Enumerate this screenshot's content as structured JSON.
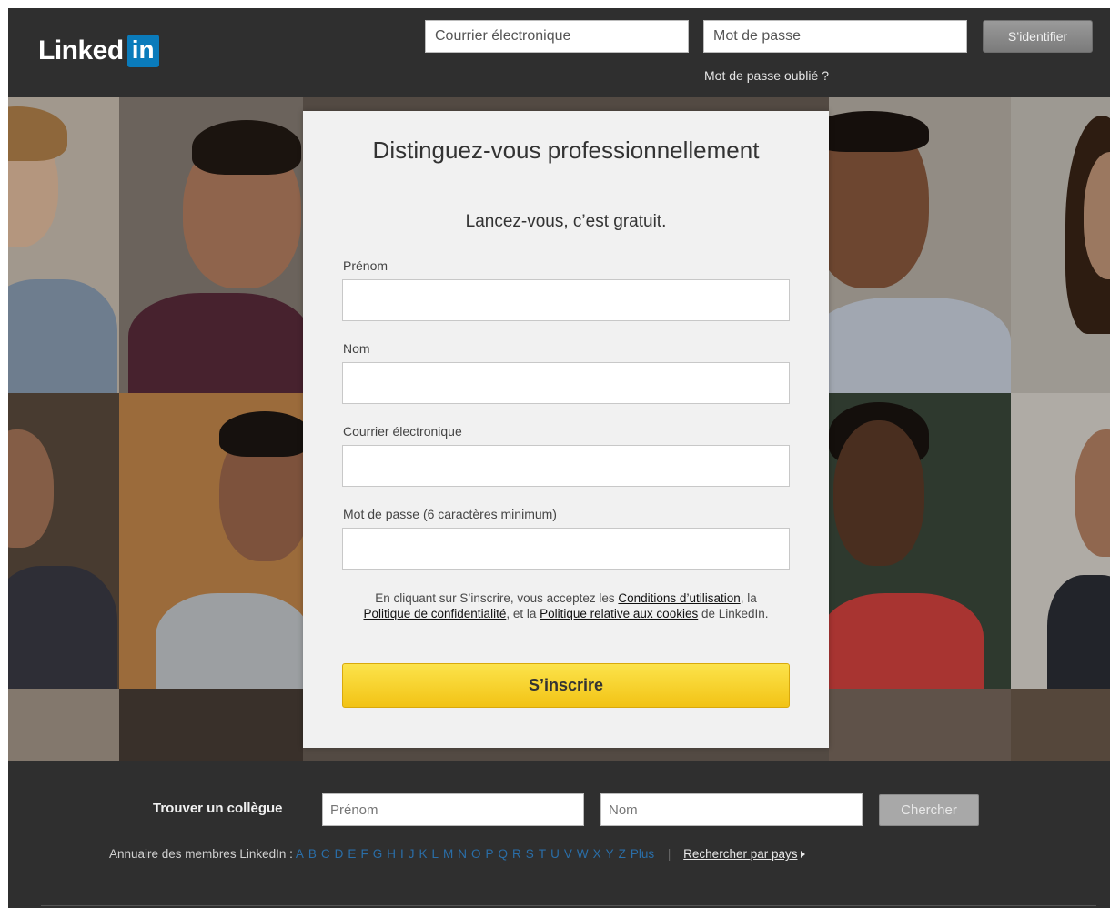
{
  "header": {
    "logo_word": "Linked",
    "logo_box": "in",
    "email_placeholder": "Courrier électronique",
    "password_placeholder": "Mot de passe",
    "signin_label": "S’identifier",
    "forgot_label": "Mot de passe oublié ?"
  },
  "signup": {
    "title": "Distinguez-vous professionnellement",
    "subtitle": "Lancez-vous, c’est gratuit.",
    "first_name_label": "Prénom",
    "last_name_label": "Nom",
    "email_label": "Courrier électronique",
    "password_label": "Mot de passe (6 caractères minimum)",
    "terms_1": "En cliquant sur S’inscrire, vous acceptez les ",
    "terms_link_1": "Conditions d’utilisation",
    "terms_2": ", la ",
    "terms_link_2": "Politique de confidentialité",
    "terms_3": ", et la ",
    "terms_link_3": "Politique relative aux cookies",
    "terms_4": " de LinkedIn.",
    "submit_label": "S’inscrire"
  },
  "footer": {
    "find_label": "Trouver un collègue",
    "first_placeholder": "Prénom",
    "last_placeholder": "Nom",
    "search_label": "Chercher",
    "directory_label": "Annuaire des membres LinkedIn :",
    "letters": [
      "A",
      "B",
      "C",
      "D",
      "E",
      "F",
      "G",
      "H",
      "I",
      "J",
      "K",
      "L",
      "M",
      "N",
      "O",
      "P",
      "Q",
      "R",
      "S",
      "T",
      "U",
      "V",
      "W",
      "X",
      "Y",
      "Z"
    ],
    "more_label": "Plus",
    "country_label": "Rechercher par pays"
  },
  "colors": {
    "brand_blue": "#0a7bbb",
    "signup_yellow": "#f5cb1e",
    "header_bg": "#2f2f2f",
    "directory_link": "#2a6ea8"
  }
}
